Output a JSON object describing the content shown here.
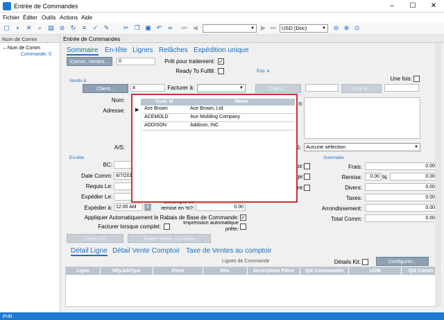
{
  "window": {
    "title": "Entrée de Commandes",
    "minimize": "–",
    "maximize": "☐",
    "close": "✕"
  },
  "menu": [
    "Fichier",
    "Éditer",
    "Outils",
    "Actions",
    "Aide"
  ],
  "toolbar": {
    "currency": "USD (Doc)"
  },
  "left_panel": {
    "header": "Num de Comm",
    "tree_root": "Num de Comm",
    "tree_child": "Commande: 0"
  },
  "main": {
    "header": "Entrée de Commandes",
    "tabs": [
      "Sommaire",
      "En-tête",
      "Lignes",
      "Relâches",
      "Expédition unique"
    ],
    "comm_ventes_btn": "Comm. Ventes...",
    "comm_ventes_value": "0",
    "pret_traitement": "Prêt pour traitement:",
    "ready_fulfill": "Ready To Fulfill:",
    "exp_a": "Exp. à",
    "une_fois": "Une fois:",
    "vendu_a": "Vendu à:",
    "client_btn": "Client...",
    "client_input": "a",
    "facturer_a": "Facturer à:",
    "client_btn2": "Client...",
    "livre_btn": "Livré à...",
    "nom": "Nom:",
    "adresse": "Adresse:",
    "on_label": "n:",
    "as_label": "A/S:",
    "s_label": "S:",
    "aucune_selection": "Aucune sélection",
    "en_tete": "En-tête",
    "sommaire": "Sommaire",
    "bc": "BC:",
    "date_comm": "Date Comm:",
    "date_value": "8/7/201",
    "requis_le": "Requis Le:",
    "expedier_le": "Expédier Le:",
    "expedier_a": "Expédier à:",
    "heure": "12:00 AM",
    "escompte": "Escompte ou remise en %?:",
    "escompte_value": "0.00",
    "appliquer": "Appliquer Automatiquement le Rabais de Base de Commande:",
    "facturer_complet": "Facturer lorsque complet:",
    "impression": "Impression automatique prête:",
    "creer_bt": "Créer BT",
    "traiter": "Traiter Vente Comptoir",
    "oir": "oir:",
    "ge": "ge:",
    "re": "re:",
    "frais": "Frais:",
    "frais_v": "0.00",
    "remise": "Remise:",
    "remise_pct": "0.00",
    "pct": "%",
    "remise_v": "0.00",
    "divers": "Divers:",
    "divers_v": "0.00",
    "taxes": "Taxes:",
    "taxes_v": "0.00",
    "arrondissement": "Arrondissement:",
    "arr_v": "0.00",
    "total": "Total Comm:",
    "total_v": "0.00"
  },
  "popup": {
    "headers": [
      "Cust. Id",
      "Name"
    ],
    "rows": [
      {
        "id": "Ace Brown",
        "name": "Ace Brown, Ltd"
      },
      {
        "id": "ACEMOLD",
        "name": "Ace Moliding Company"
      },
      {
        "id": "ADDISON",
        "name": "Addison, INC"
      }
    ]
  },
  "bottom": {
    "tabs": [
      "Détail Ligne",
      "Détail Vente Comptoir",
      "Taxe de Ventes au comptoir"
    ],
    "lignes_commande": "Lignes de Commande",
    "details_kit": "Détails Kit:",
    "configurer": "Configurer...",
    "columns": [
      "Ligne",
      "MfgJobType",
      "Pièce",
      "Rév.",
      "Description Pièce",
      "Qté Commandée",
      "UOM",
      "Qté Comm."
    ]
  },
  "status": "Prêt"
}
